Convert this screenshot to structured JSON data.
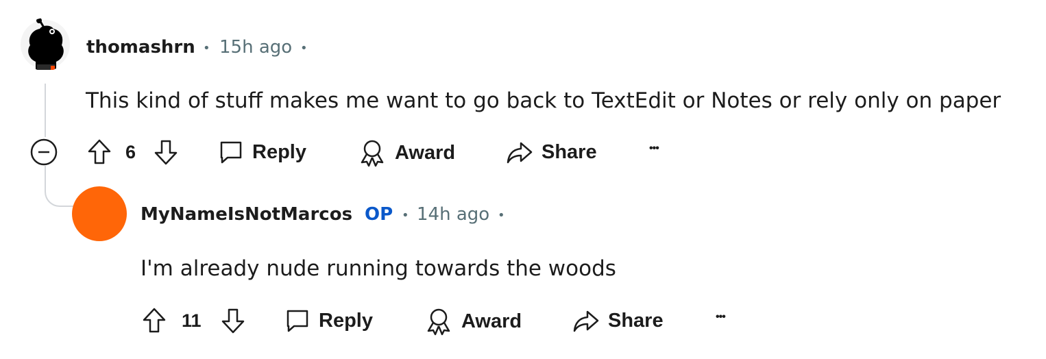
{
  "comments": [
    {
      "author": "thomashrn",
      "separator_before": "•",
      "time": "15h ago",
      "separator_after": "•",
      "text": "This kind of stuff makes me want to go back to TextEdit or Notes or rely only on paper",
      "votes": "6",
      "actions": {
        "reply": "Reply",
        "award": "Award",
        "share": "Share",
        "more": "•••"
      },
      "avatar_icon": "user-avatar-icon"
    },
    {
      "author": "MyNameIsNotMarcos",
      "badge": "OP",
      "separator_before": "•",
      "time": "14h ago",
      "separator_after": "•",
      "text": "I'm already nude running towards the woods",
      "votes": "11",
      "actions": {
        "reply": "Reply",
        "award": "Award",
        "share": "Share",
        "more": "•••"
      },
      "avatar_color": "#ff6608"
    }
  ],
  "colors": {
    "op_badge": "#0a58ca",
    "meta_gray": "#576f76",
    "thread_line": "#d3d6da"
  }
}
